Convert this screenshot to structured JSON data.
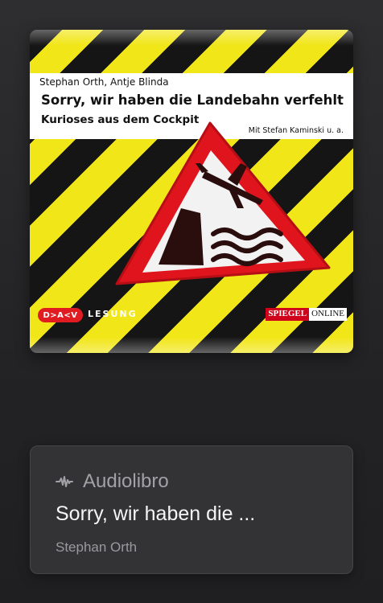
{
  "cover": {
    "authors": "Stephan Orth, Antje Blinda",
    "title": "Sorry, wir haben die Landebahn verfehlt",
    "subtitle": "Kurioses aus dem Cockpit",
    "contributors": "Mit Stefan Kaminski u. a.",
    "publisher_logo": "D>A<V",
    "series_label": "LESUNG",
    "partner_logo_part1": "SPIEGEL",
    "partner_logo_part2": "ONLINE",
    "colors": {
      "stripe_yellow": "#f1e617",
      "stripe_black": "#151515",
      "sign_red": "#e0141c"
    }
  },
  "card": {
    "type_icon": "waveform-icon",
    "type_label": "Audiolibro",
    "title": "Sorry, wir haben die ...",
    "author": "Stephan Orth"
  }
}
